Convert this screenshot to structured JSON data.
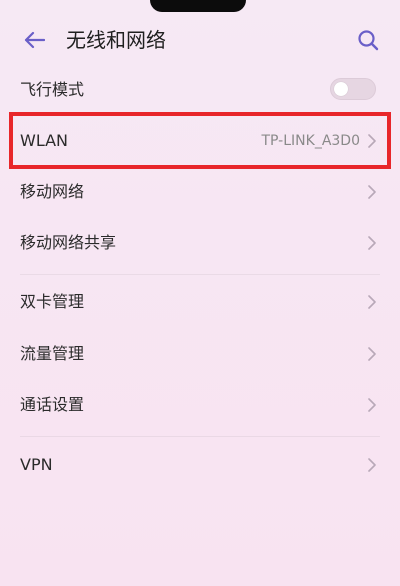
{
  "status_bar": {
    "text": "—— ·· ——"
  },
  "header": {
    "title": "无线和网络",
    "back_icon": "arrow-left-icon",
    "search_icon": "search-icon"
  },
  "settings": {
    "airplane_mode": {
      "label": "飞行模式",
      "toggle_state": "off"
    },
    "wlan": {
      "label": "WLAN",
      "value": "TP-LINK_A3D0"
    },
    "mobile_network": {
      "label": "移动网络"
    },
    "tethering": {
      "label": "移动网络共享"
    },
    "dual_sim": {
      "label": "双卡管理"
    },
    "data_usage": {
      "label": "流量管理"
    },
    "call_settings": {
      "label": "通话设置"
    },
    "vpn": {
      "label": "VPN"
    }
  },
  "colors": {
    "accent": "#6a5fc8",
    "highlight": "#e8262a",
    "background": "#f7e6f3"
  }
}
